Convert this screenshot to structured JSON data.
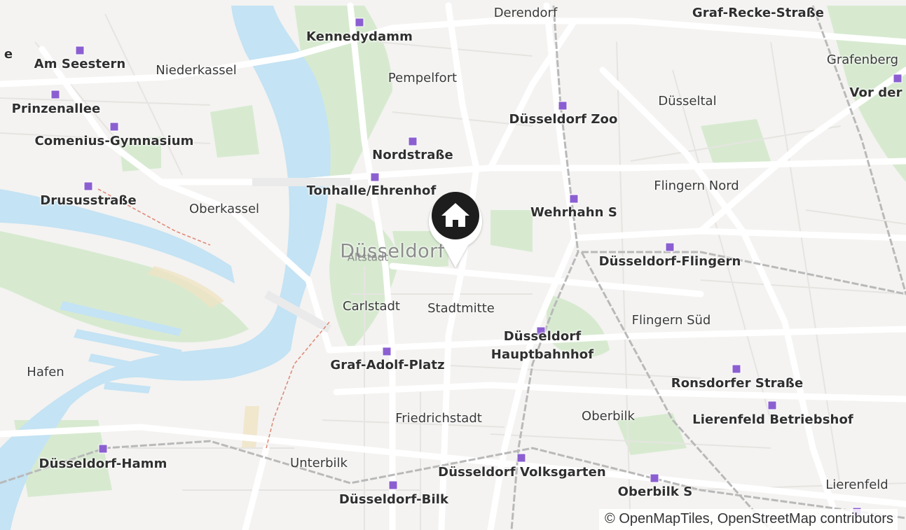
{
  "map": {
    "city_label": "Düsseldorf",
    "old_town_label": "Altstadt",
    "colors": {
      "water": "#c4e3f4",
      "green": "#d7ead0",
      "road": "#ffffff",
      "land": "#f4f3f1",
      "stop": "#8b5fd1",
      "marker": "#1d1d1d"
    },
    "stations": [
      {
        "name": "Kennedydamm"
      },
      {
        "name": "Derendorf"
      },
      {
        "name": "Graf-Recke-Straße"
      },
      {
        "name": "Am Seestern"
      },
      {
        "name": "Prinzenallee"
      },
      {
        "name": "Comenius-Gymnasium"
      },
      {
        "name": "Drususstraße"
      },
      {
        "name": "Nordstraße"
      },
      {
        "name": "Tonhalle/Ehrenhof"
      },
      {
        "name": "Düsseldorf Zoo"
      },
      {
        "name": "Wehrhahn S"
      },
      {
        "name": "Düsseldorf-Flingern"
      },
      {
        "name": "Vor der"
      },
      {
        "name": "Düsseldorf Hauptbahnhof"
      },
      {
        "name": "Graf-Adolf-Platz"
      },
      {
        "name": "Ronsdorfer Straße"
      },
      {
        "name": "Lierenfeld Betriebshof"
      },
      {
        "name": "Düsseldorf-Hamm"
      },
      {
        "name": "Düsseldorf Volksgarten"
      },
      {
        "name": "Oberbilk S"
      },
      {
        "name": "Düsseldorf-Bilk"
      }
    ],
    "districts": [
      {
        "name": "Niederkassel"
      },
      {
        "name": "Pempelfort"
      },
      {
        "name": "Düsseltal"
      },
      {
        "name": "Grafenberg"
      },
      {
        "name": "Flingern Nord"
      },
      {
        "name": "Oberkassel"
      },
      {
        "name": "Carlstadt"
      },
      {
        "name": "Stadtmitte"
      },
      {
        "name": "Flingern Süd"
      },
      {
        "name": "Hafen"
      },
      {
        "name": "Friedrichstadt"
      },
      {
        "name": "Oberbilk"
      },
      {
        "name": "Unterbilk"
      },
      {
        "name": "Lierenfeld"
      }
    ],
    "edge_fragment": "e",
    "marker": {
      "icon": "home-icon"
    },
    "attribution": "© OpenMapTiles, OpenStreetMap contributors"
  }
}
